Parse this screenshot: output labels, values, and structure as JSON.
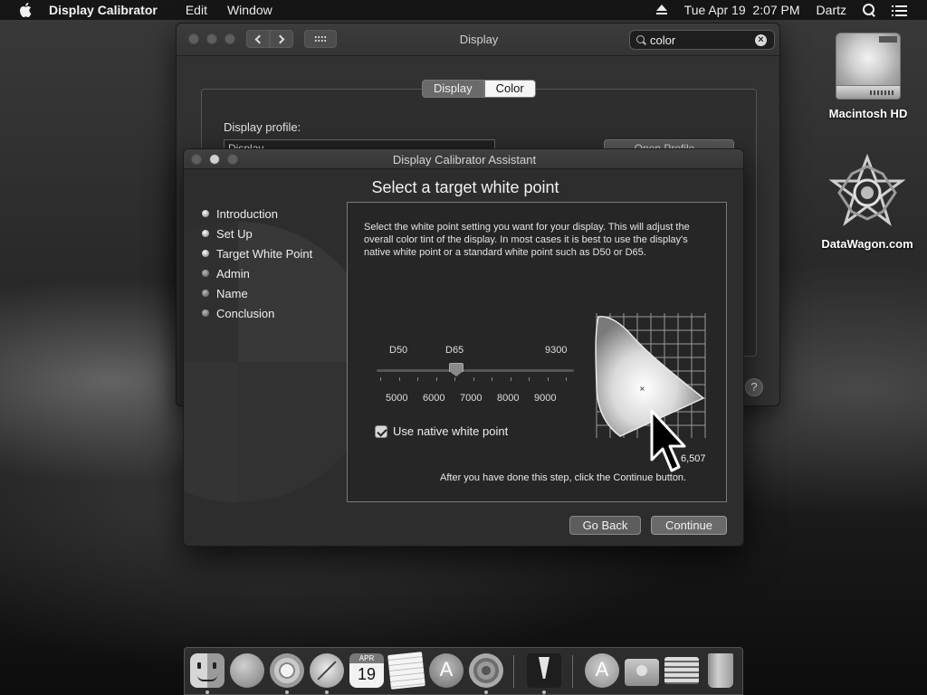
{
  "menubar": {
    "app_name": "Display Calibrator",
    "items": [
      "Edit",
      "Window"
    ],
    "clock": "Tue Apr 19  2:07 PM",
    "user": "Dartz"
  },
  "desktop": {
    "icons": [
      {
        "label": "Macintosh HD",
        "icon": "hard-drive-icon"
      },
      {
        "label": "DataWagon.com",
        "icon": "star-logo-icon"
      }
    ]
  },
  "prefs_window": {
    "title": "Display",
    "search_value": "color",
    "tabs": [
      {
        "label": "Display",
        "selected": false
      },
      {
        "label": "Color",
        "selected": true
      }
    ],
    "profile_label": "Display profile:",
    "profile_list_first": "Display",
    "open_profile_label": "Open Profile...",
    "help": "?"
  },
  "calibrator": {
    "title": "Display Calibrator Assistant",
    "heading": "Select a target white point",
    "steps": [
      {
        "label": "Introduction",
        "done": true
      },
      {
        "label": "Set Up",
        "done": true
      },
      {
        "label": "Target White Point",
        "done": true
      },
      {
        "label": "Admin",
        "done": false
      },
      {
        "label": "Name",
        "done": false
      },
      {
        "label": "Conclusion",
        "done": false
      }
    ],
    "description": "Select the white point setting you want for your display.  This will adjust the overall color tint of the display.  In most cases it is best to use the display's native white point or a standard white point such as D50 or D65.",
    "slider": {
      "top_labels": [
        "D50",
        "D65",
        "9300"
      ],
      "bottom_labels": [
        "5000",
        "6000",
        "7000",
        "8000",
        "9000"
      ],
      "value_label": "D65"
    },
    "native_checkbox": {
      "label": "Use native white point",
      "checked": true
    },
    "kelvin_readout": "6,507",
    "after_text": "After you have done this step, click the Continue button.",
    "buttons": {
      "back": "Go Back",
      "continue": "Continue"
    }
  },
  "dock": {
    "apps": [
      "finder-icon",
      "launchpad-icon",
      "chrome-icon",
      "safari-icon",
      "calendar-icon",
      "notes-icon",
      "app-store-icon",
      "system-preferences-icon",
      "tuxera-icon",
      "applications-folder-icon",
      "downloads-folder-icon",
      "documents-stack-icon",
      "trash-icon"
    ],
    "calendar_day": "19"
  }
}
